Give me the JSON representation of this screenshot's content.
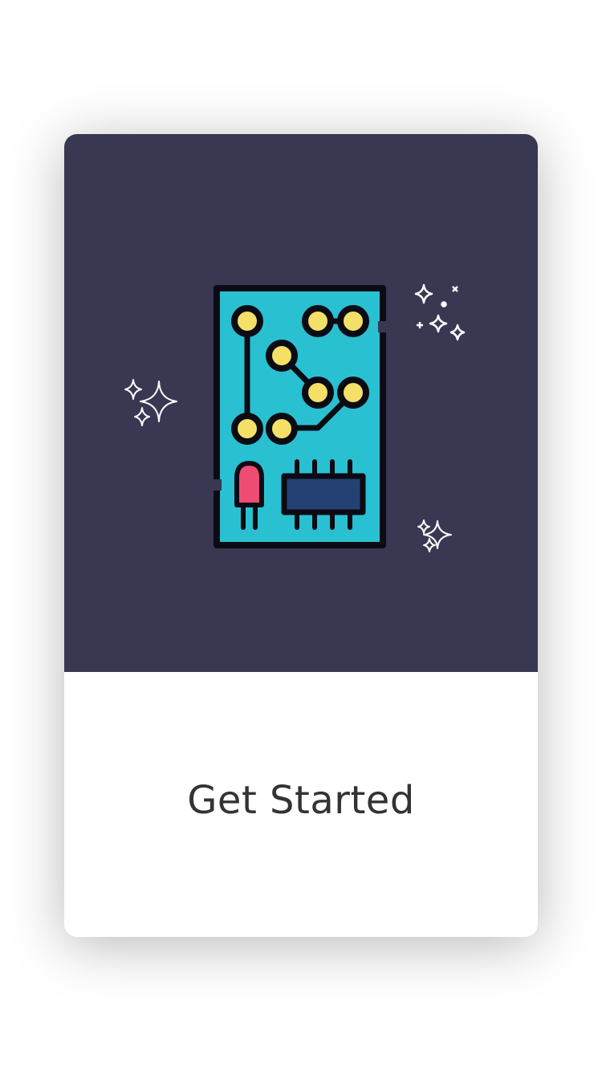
{
  "onboarding": {
    "illustration_icon": "circuit-board-icon",
    "sparkle_icon": "sparkle-icon",
    "cta_label": "Get Started"
  },
  "colors": {
    "hero_background": "#393853",
    "board": "#29C1D1",
    "pad": "#F4E066",
    "chip": "#254072",
    "led": "#EE4C72",
    "outline": "#0B0B14",
    "sparkle": "#FFFFFF",
    "text": "#333333"
  }
}
